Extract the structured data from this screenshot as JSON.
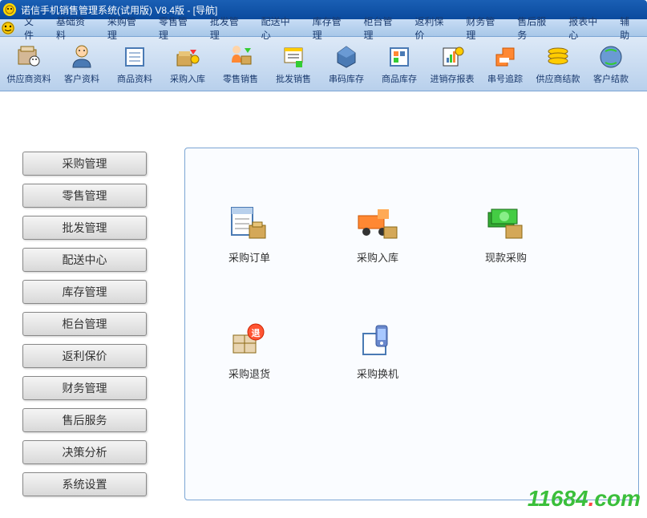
{
  "titlebar": {
    "title": "诺信手机销售管理系统(试用版)  V8.4版 - [导航]"
  },
  "menu": {
    "items": [
      "文件",
      "基础资料",
      "采购管理",
      "零售管理",
      "批发管理",
      "配送中心",
      "库存管理",
      "柜台管理",
      "返利保价",
      "财务管理",
      "售后服务",
      "报表中心",
      "辅助"
    ]
  },
  "toolbar": {
    "items": [
      {
        "label": "供应商资料",
        "icon": "supplier"
      },
      {
        "label": "客户资料",
        "icon": "customer"
      },
      {
        "label": "商品资料",
        "icon": "goods"
      },
      {
        "label": "采购入库",
        "icon": "purchase-in"
      },
      {
        "label": "零售销售",
        "icon": "retail"
      },
      {
        "label": "批发销售",
        "icon": "wholesale"
      },
      {
        "label": "串码库存",
        "icon": "serial-stock"
      },
      {
        "label": "商品库存",
        "icon": "goods-stock"
      },
      {
        "label": "进销存报表",
        "icon": "report"
      },
      {
        "label": "串号追踪",
        "icon": "track"
      },
      {
        "label": "供应商结款",
        "icon": "supplier-pay"
      },
      {
        "label": "客户结款",
        "icon": "customer-pay"
      }
    ]
  },
  "sidebar": {
    "items": [
      "采购管理",
      "零售管理",
      "批发管理",
      "配送中心",
      "库存管理",
      "柜台管理",
      "返利保价",
      "财务管理",
      "售后服务",
      "决策分析",
      "系统设置"
    ]
  },
  "main": {
    "items": [
      {
        "label": "采购订单",
        "icon": "order"
      },
      {
        "label": "采购入库",
        "icon": "inbound"
      },
      {
        "label": "现款采购",
        "icon": "cash"
      },
      {
        "label": "采购退货",
        "icon": "return"
      },
      {
        "label": "采购换机",
        "icon": "exchange"
      }
    ]
  },
  "watermark": {
    "text1": "11684",
    "dot": ".",
    "text2": "com"
  }
}
